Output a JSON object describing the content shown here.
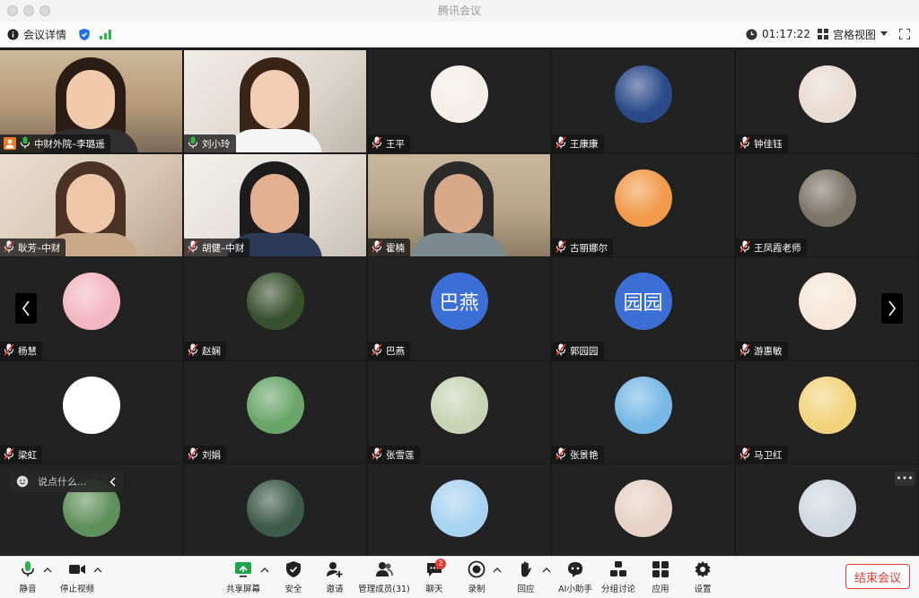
{
  "window": {
    "title": "腾讯会议"
  },
  "infobar": {
    "meeting_info": "会议详情",
    "elapsed": "01:17:22",
    "view_mode": "宫格视图"
  },
  "participants": [
    {
      "name": "中财外院–李璐遥",
      "avatar": "video"
    },
    {
      "name": "刘小玲",
      "avatar": "video"
    },
    {
      "name": "王平",
      "avatar": "image",
      "color": "#f4eee8"
    },
    {
      "name": "王康康",
      "avatar": "image",
      "color": "#2a4a8a"
    },
    {
      "name": "钟佳钰",
      "avatar": "image",
      "color": "#e9dcd3"
    },
    {
      "name": "耿芳–中财",
      "avatar": "video"
    },
    {
      "name": "胡健–中财",
      "avatar": "video"
    },
    {
      "name": "霍楠",
      "avatar": "video"
    },
    {
      "name": "古丽娜尔",
      "avatar": "image",
      "color": "#f09a4a"
    },
    {
      "name": "王凤霞老师",
      "avatar": "image",
      "color": "#7d7468"
    },
    {
      "name": "杨慧",
      "avatar": "image",
      "color": "#f3b7c3"
    },
    {
      "name": "赵娴",
      "avatar": "image",
      "color": "#39502f"
    },
    {
      "name": "巴燕",
      "avatar": "text",
      "text": "巴燕",
      "color": "#3b6fd6"
    },
    {
      "name": "郭园园",
      "avatar": "text",
      "text": "园园",
      "color": "#3b6fd6"
    },
    {
      "name": "游惠敏",
      "avatar": "image",
      "color": "#f6e7d8"
    },
    {
      "name": "梁虹",
      "avatar": "image",
      "color": "#ffffff"
    },
    {
      "name": "刘娟",
      "avatar": "image",
      "color": "#6aa56a"
    },
    {
      "name": "张雪莲",
      "avatar": "image",
      "color": "#c9d4b6"
    },
    {
      "name": "张景艳",
      "avatar": "image",
      "color": "#78b8e6"
    },
    {
      "name": "马卫红",
      "avatar": "image",
      "color": "#f2d47e"
    },
    {
      "name": "",
      "avatar": "image",
      "color": "#5f8f5a"
    },
    {
      "name": "",
      "avatar": "image",
      "color": "#3d5a4a"
    },
    {
      "name": "",
      "avatar": "image",
      "color": "#a9d3f2"
    },
    {
      "name": "",
      "avatar": "image",
      "color": "#e6d2c6"
    },
    {
      "name": "",
      "avatar": "image",
      "color": "#cfd8e0"
    }
  ],
  "chat_popup": {
    "placeholder": "说点什么..."
  },
  "toolbar": {
    "mute": "静音",
    "stop_video": "停止视频",
    "share": "共享屏幕",
    "security": "安全",
    "invite": "邀请",
    "manage": "管理成员(31)",
    "chat": "聊天",
    "chat_badge": "2",
    "record": "录制",
    "reaction": "回应",
    "ai": "AI小助手",
    "breakout": "分组讨论",
    "apps": "应用",
    "settings": "设置",
    "end": "结束会议"
  }
}
